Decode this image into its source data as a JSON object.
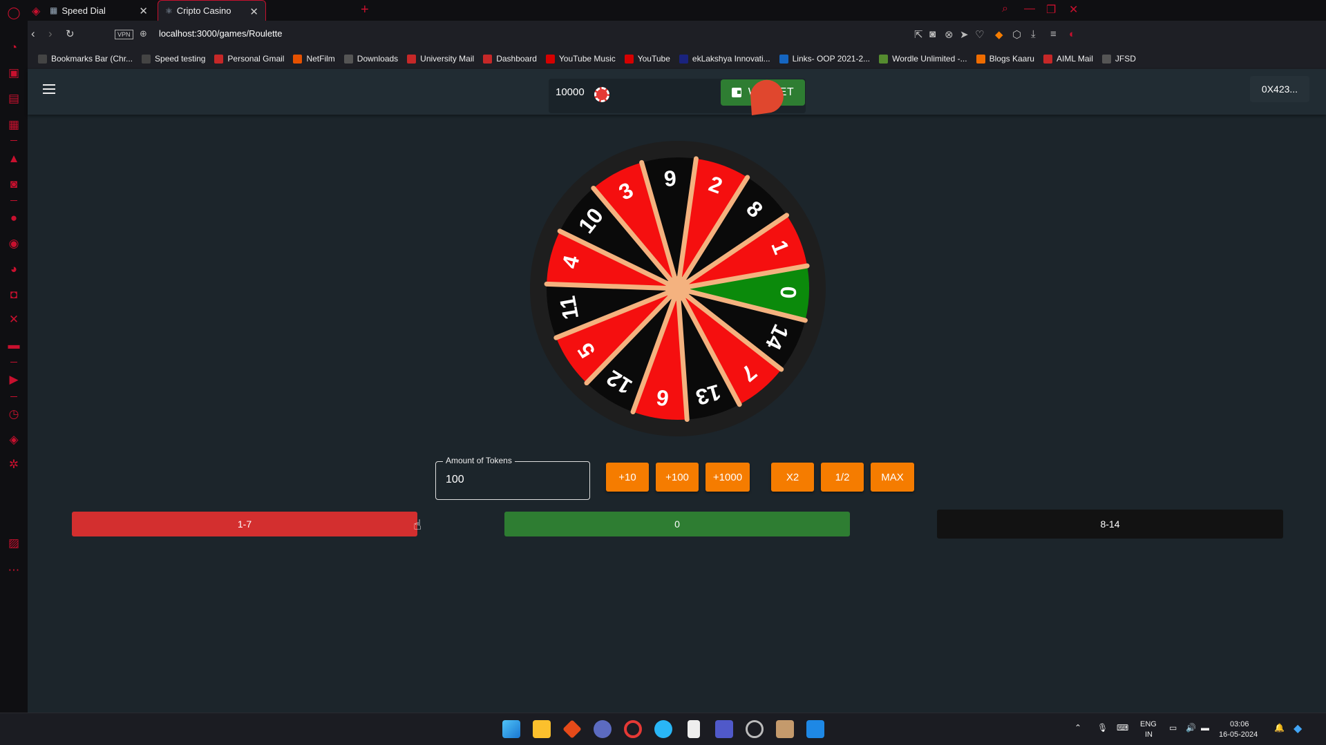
{
  "browser": {
    "tabs": [
      {
        "label": "Speed Dial",
        "icon": "grid-icon"
      },
      {
        "label": "Cripto Casino",
        "icon": "react-icon",
        "active": true
      }
    ],
    "vpn_label": "VPN",
    "url": "localhost:3000/games/Roulette",
    "bookmarks": [
      {
        "label": "Bookmarks Bar (Chr...",
        "icon": "folder-icon",
        "color": "#444"
      },
      {
        "label": "Speed testing",
        "icon": "folder-icon",
        "color": "#444"
      },
      {
        "label": "Personal Gmail",
        "icon": "gmail-icon",
        "color": "#c62828"
      },
      {
        "label": "NetFilm",
        "icon": "netfilm-icon",
        "color": "#e65100"
      },
      {
        "label": "Downloads",
        "icon": "download-icon",
        "color": "#555"
      },
      {
        "label": "University Mail",
        "icon": "gmail-icon",
        "color": "#c62828"
      },
      {
        "label": "Dashboard",
        "icon": "dashboard-icon",
        "color": "#c62828"
      },
      {
        "label": "YouTube Music",
        "icon": "youtube-music-icon",
        "color": "#d50000"
      },
      {
        "label": "YouTube",
        "icon": "youtube-icon",
        "color": "#d50000"
      },
      {
        "label": "ekLakshya Innovati...",
        "icon": "e-icon",
        "color": "#1a237e"
      },
      {
        "label": "Links- OOP 2021-2...",
        "icon": "doc-icon",
        "color": "#1565c0"
      },
      {
        "label": "Wordle Unlimited -...",
        "icon": "w-icon",
        "color": "#558b2f"
      },
      {
        "label": "Blogs Kaaru",
        "icon": "blogger-icon",
        "color": "#ef6c00"
      },
      {
        "label": "AIML Mail",
        "icon": "gmail-icon",
        "color": "#c62828"
      },
      {
        "label": "JFSD",
        "icon": "jfsd-icon",
        "color": "#555"
      }
    ]
  },
  "header": {
    "balance": "10000",
    "wallet_label": "WALLET",
    "account": "0X423..."
  },
  "wheel": {
    "segments": [
      {
        "num": "0",
        "color": "green"
      },
      {
        "num": "14",
        "color": "black"
      },
      {
        "num": "7",
        "color": "red"
      },
      {
        "num": "13",
        "color": "black"
      },
      {
        "num": "6",
        "color": "red"
      },
      {
        "num": "12",
        "color": "black"
      },
      {
        "num": "5",
        "color": "red"
      },
      {
        "num": "11",
        "color": "black"
      },
      {
        "num": "4",
        "color": "red"
      },
      {
        "num": "10",
        "color": "black"
      },
      {
        "num": "3",
        "color": "red"
      },
      {
        "num": "9",
        "color": "black"
      },
      {
        "num": "2",
        "color": "red"
      },
      {
        "num": "8",
        "color": "black"
      },
      {
        "num": "1",
        "color": "red"
      }
    ],
    "colors": {
      "red": "#f50f0f",
      "black": "#0a0a0a",
      "green": "#0b8a0b",
      "spoke": "#f4b27f",
      "rim": "#1e1e1e"
    }
  },
  "bet": {
    "amount_label": "Amount of Tokens",
    "amount_value": "100",
    "buttons": [
      "+10",
      "+100",
      "+1000",
      "X2",
      "1/2",
      "MAX"
    ],
    "options": [
      {
        "label": "1-7",
        "color": "#d32f2f"
      },
      {
        "label": "0",
        "color": "#2e7d32"
      },
      {
        "label": "8-14",
        "color": "#121212"
      }
    ]
  },
  "taskbar": {
    "language": "ENG",
    "region": "IN",
    "time": "03:06",
    "date": "16-05-2024"
  }
}
